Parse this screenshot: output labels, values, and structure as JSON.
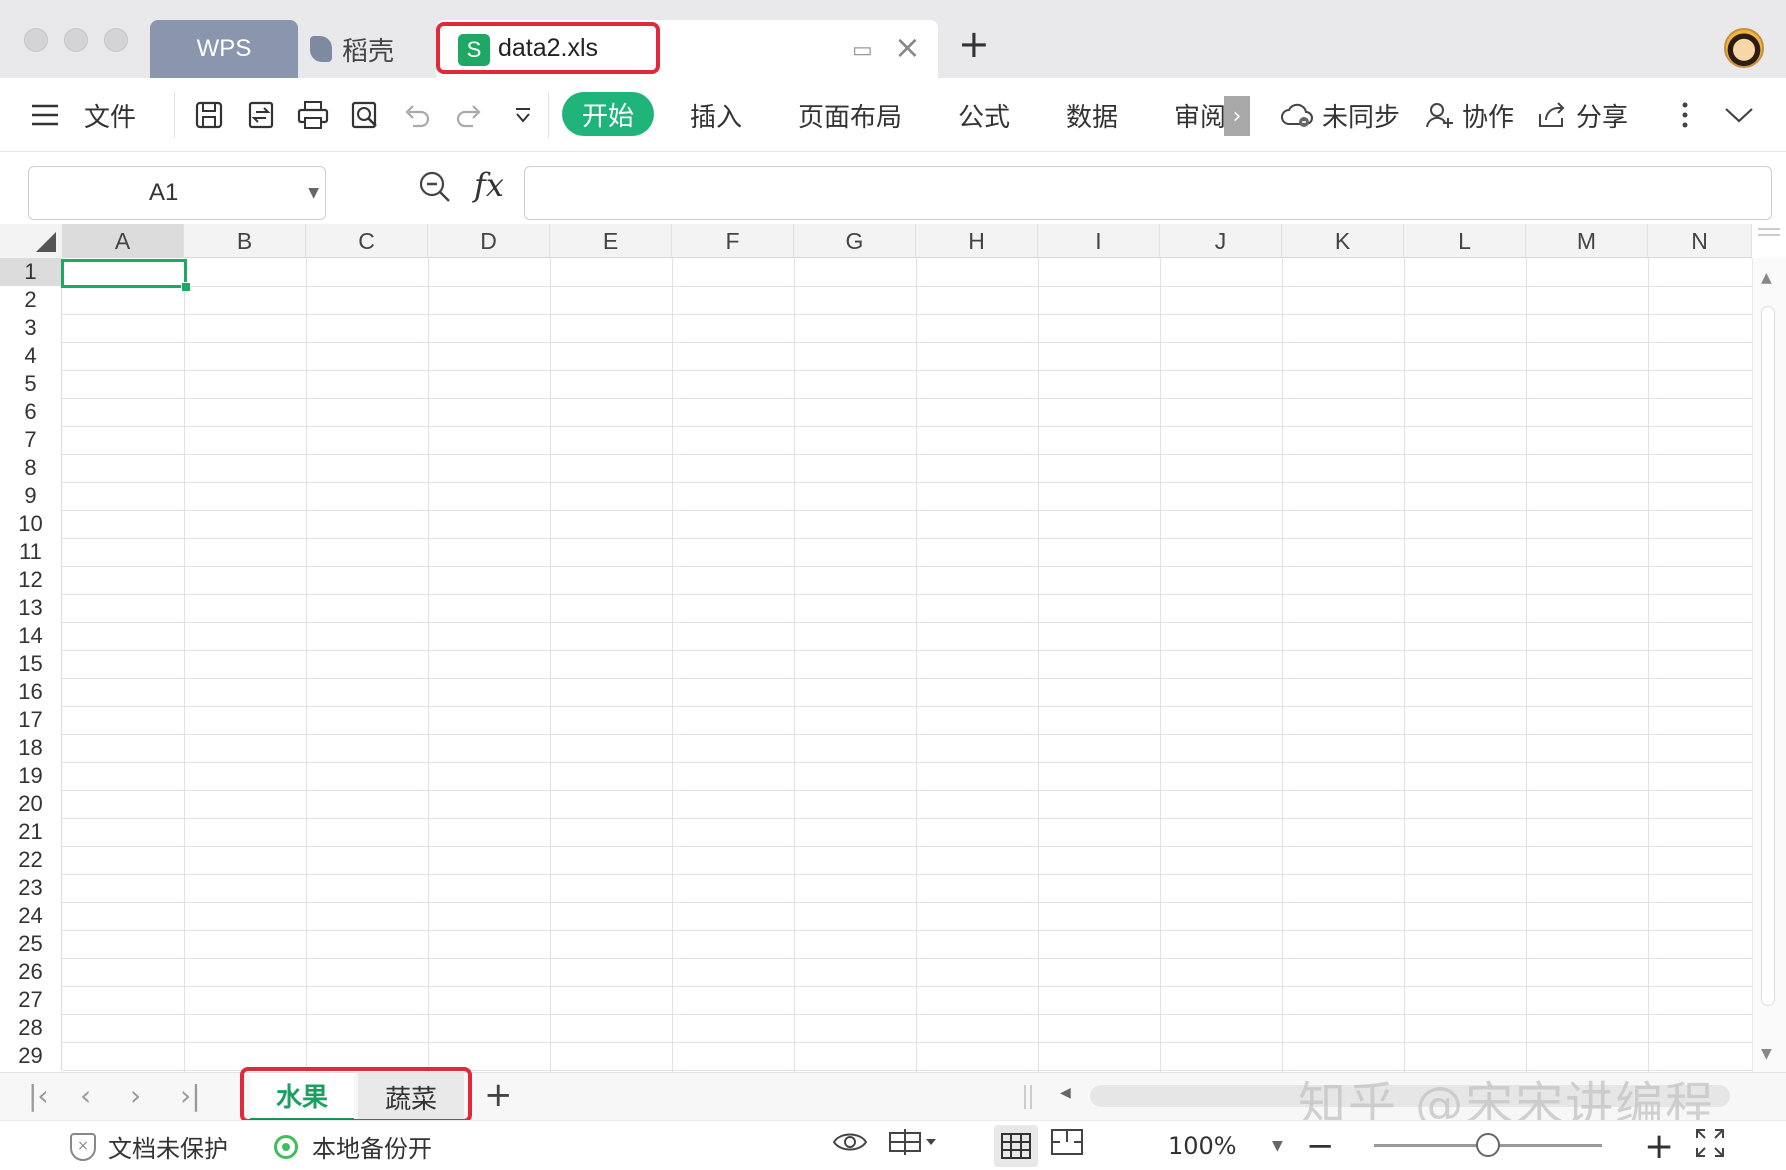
{
  "tabs": {
    "wps": "WPS",
    "daoke": "稻壳",
    "active_file": "data2.xls",
    "xls_icon_letter": "S",
    "add": "+"
  },
  "toolbar": {
    "menu": "文件",
    "start": "开始",
    "insert": "插入",
    "page_layout": "页面布局",
    "formula": "公式",
    "data": "数据",
    "review": "审阅",
    "sync": "未同步",
    "collab": "协作",
    "share": "分享"
  },
  "formula_bar": {
    "name_box": "A1",
    "fx": "fx",
    "value": ""
  },
  "grid": {
    "columns": [
      "A",
      "B",
      "C",
      "D",
      "E",
      "F",
      "G",
      "H",
      "I",
      "J",
      "K",
      "L",
      "M",
      "N"
    ],
    "rows": [
      "1",
      "2",
      "3",
      "4",
      "5",
      "6",
      "7",
      "8",
      "9",
      "10",
      "11",
      "12",
      "13",
      "14",
      "15",
      "16",
      "17",
      "18",
      "19",
      "20",
      "21",
      "22",
      "23",
      "24",
      "25",
      "26",
      "27",
      "28",
      "29"
    ],
    "selected_cell": "A1"
  },
  "sheets": {
    "active": "水果",
    "other": "蔬菜",
    "add": "+"
  },
  "watermark": "知乎 @宋宋讲编程",
  "status": {
    "protect": "文档未保护",
    "backup": "本地备份开",
    "zoom": "100%"
  },
  "colors": {
    "accent_green": "#1fb57a",
    "highlight_red": "#e02a3a",
    "wps_tab": "#8996ad"
  },
  "icons": [
    "hamburger-icon",
    "save-icon",
    "export-icon",
    "print-icon",
    "print-preview-icon",
    "undo-icon",
    "redo-icon",
    "customize-icon",
    "cloud-sync-icon",
    "collab-icon",
    "share-icon",
    "more-icon",
    "collapse-icon",
    "zoom-search-icon",
    "eye-icon",
    "freeze-icon",
    "normal-view-icon",
    "page-view-icon",
    "fullscreen-icon"
  ]
}
